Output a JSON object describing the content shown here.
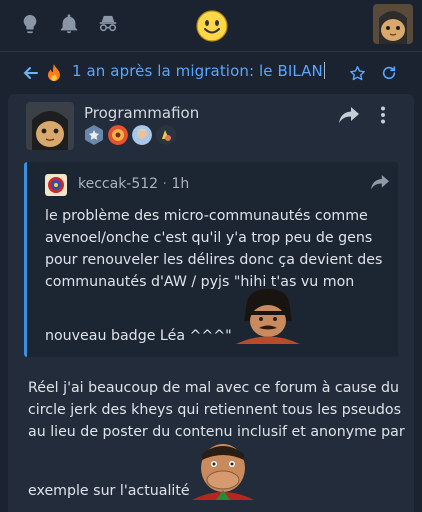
{
  "topbar": {
    "icons": [
      "lightbulb-icon",
      "bell-icon",
      "incognito-icon",
      "smile-emoji",
      "user-avatar"
    ]
  },
  "thread": {
    "title": "1 an après la migration: le BILAN",
    "icons": [
      "back-arrow-icon",
      "fire-icon",
      "star-icon",
      "refresh-icon"
    ]
  },
  "post": {
    "author": "Programmafion",
    "badges": [
      "star-badge",
      "hands-badge",
      "face-badge",
      "hat-badge"
    ],
    "quote": {
      "author": "keccak-512",
      "separator": "·",
      "time": "1h",
      "lines": [
        "le problème des micro-communautés comme",
        "avenoel/onche c'est qu'il y'a trop peu de gens",
        "pour renouveler les délires donc ça devient des",
        "communautés d'AW / pyjs \"hihi t'as vu mon"
      ],
      "last_line": "nouveau badge Léa ^^^\""
    },
    "lines": [
      "Réel j'ai beaucoup de mal avec ce forum à cause du",
      "circle jerk des kheys qui retiennent tous les pseudos",
      "au lieu de poster du contenu inclusif et anonyme par"
    ],
    "last_line": "exemple sur l'actualité"
  },
  "colors": {
    "background": "#1b2330",
    "card": "#222c3a",
    "quote_bg": "#1c2532",
    "accent": "#58a6ff",
    "quote_border": "#3d8fe0"
  }
}
